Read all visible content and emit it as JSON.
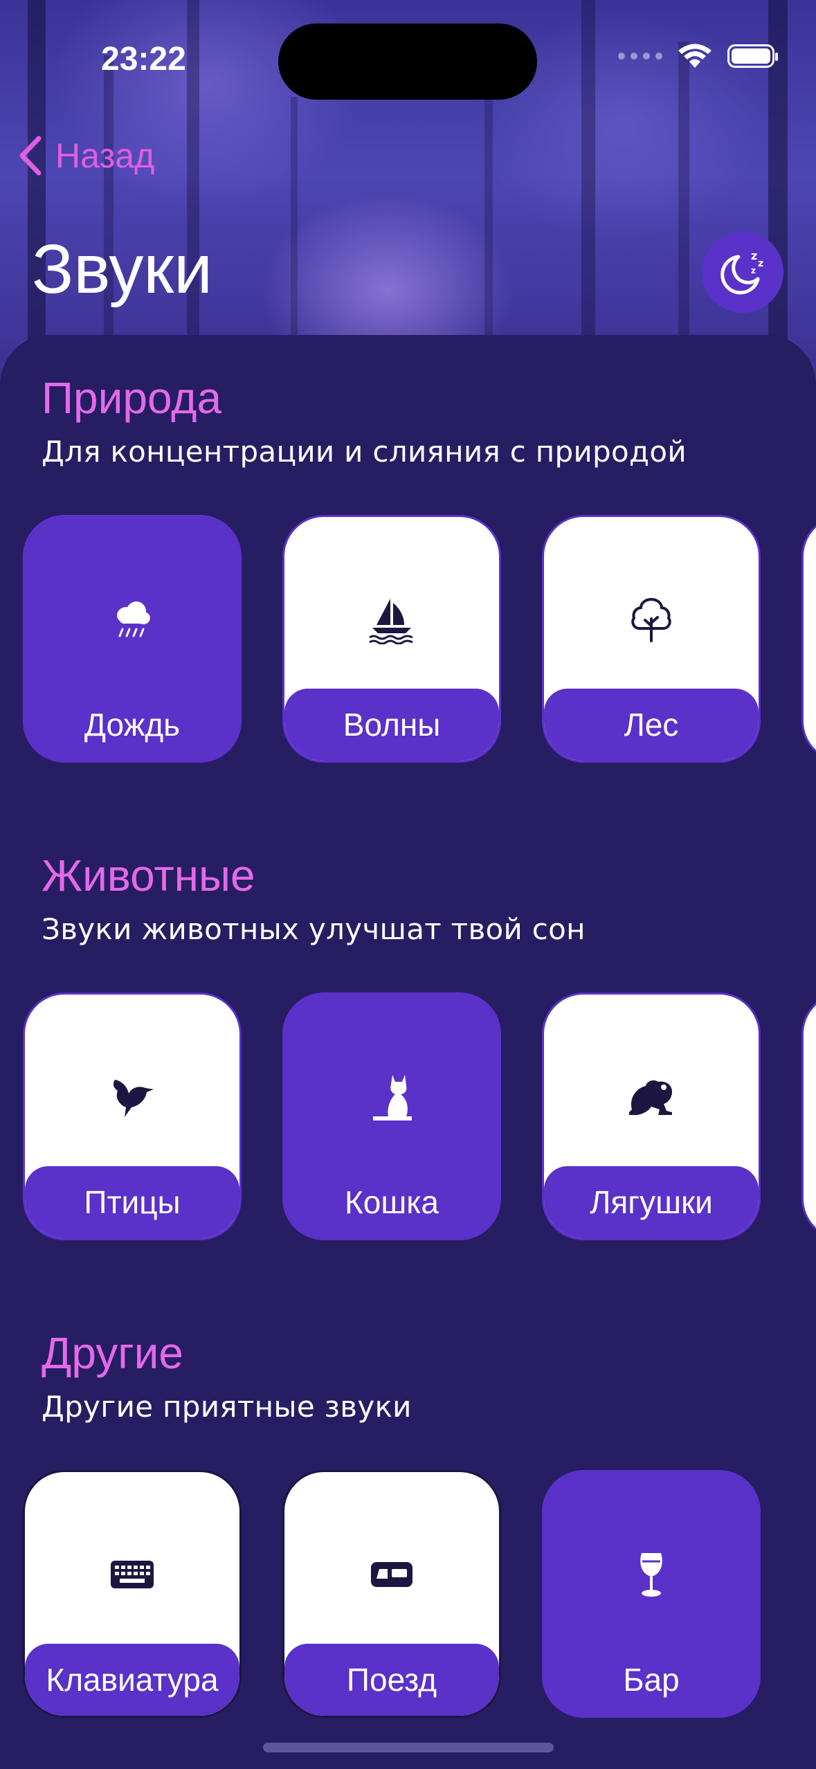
{
  "status_bar": {
    "time": "23:22"
  },
  "nav": {
    "back_label": "Назад",
    "title": "Звуки"
  },
  "sections": [
    {
      "title": "Природа",
      "subtitle": "Для концентрации и слияния с природой",
      "items": [
        {
          "label": "Дождь",
          "icon": "cloud-rain-icon",
          "active": true
        },
        {
          "label": "Волны",
          "icon": "sailboat-waves-icon",
          "active": false
        },
        {
          "label": "Лес",
          "icon": "tree-icon",
          "active": false
        }
      ]
    },
    {
      "title": "Животные",
      "subtitle": "Звуки животных улучшат твой сон",
      "items": [
        {
          "label": "Птицы",
          "icon": "bird-icon",
          "active": false
        },
        {
          "label": "Кошка",
          "icon": "cat-icon",
          "active": true
        },
        {
          "label": "Лягушки",
          "icon": "frog-icon",
          "active": false
        }
      ]
    },
    {
      "title": "Другие",
      "subtitle": "Другие приятные звуки",
      "items": [
        {
          "label": "Клавиатура",
          "icon": "keyboard-icon",
          "active": false
        },
        {
          "label": "Поезд",
          "icon": "train-icon",
          "active": false
        },
        {
          "label": "Бар",
          "icon": "wineglass-icon",
          "active": true
        }
      ]
    }
  ],
  "colors": {
    "accent": "#5a31c9",
    "title_pink": "#e36ae8",
    "panel": "#261d62",
    "icon_dark": "#1c1640"
  }
}
